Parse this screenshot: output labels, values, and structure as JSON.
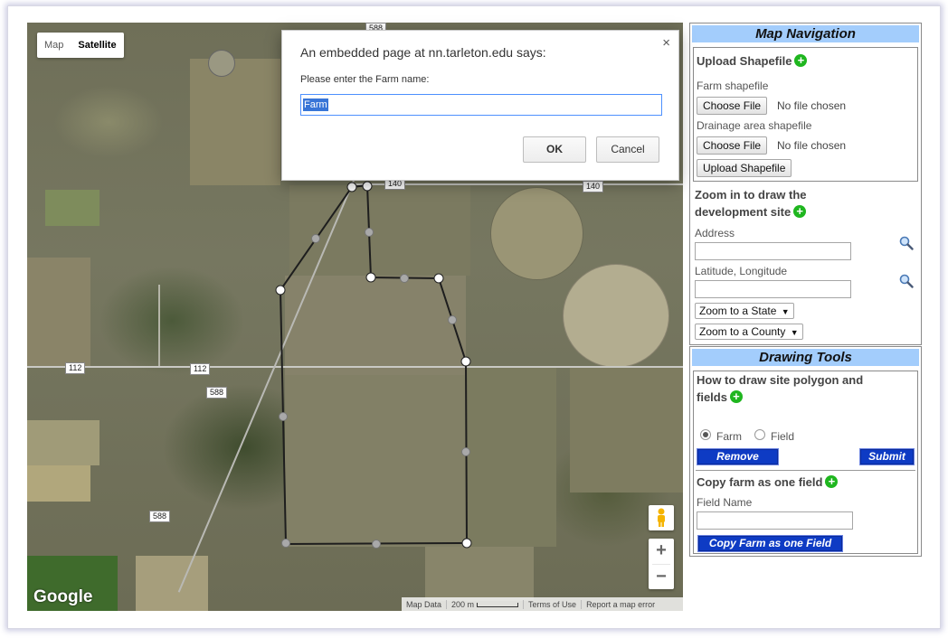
{
  "map": {
    "type_control": {
      "map_label": "Map",
      "satellite_label": "Satellite",
      "active": "Satellite"
    },
    "road_labels": [
      "588",
      "140",
      "140",
      "112",
      "112",
      "588",
      "588"
    ],
    "google_logo": "Google",
    "attribution": {
      "map_data": "Map Data",
      "scale": "200 m",
      "terms": "Terms of Use",
      "report": "Report a map error"
    },
    "zoom_in_label": "+",
    "zoom_out_label": "−",
    "icons": [
      "pegman-icon"
    ]
  },
  "dialog": {
    "title": "An embedded page at nn.tarleton.edu says:",
    "message": "Please enter the Farm name:",
    "input_value": "Farm",
    "ok_label": "OK",
    "cancel_label": "Cancel",
    "close_label": "×"
  },
  "sidebar": {
    "map_navigation": {
      "header": "Map Navigation",
      "upload": {
        "title": "Upload Shapefile",
        "farm_label": "Farm shapefile",
        "farm_button": "Choose File",
        "farm_status": "No file chosen",
        "drainage_label": "Drainage area shapefile",
        "drainage_button": "Choose File",
        "drainage_status": "No file chosen",
        "upload_button": "Upload Shapefile"
      },
      "zoom": {
        "title_line1": "Zoom in to draw the",
        "title_line2": "development site",
        "address_label": "Address",
        "address_value": "",
        "latlng_label": "Latitude, Longitude",
        "latlng_value": "",
        "state_select": "Zoom to a State",
        "county_select": "Zoom to a County"
      }
    },
    "drawing_tools": {
      "header": "Drawing Tools",
      "howto_line1": "How to draw site polygon and",
      "howto_line2": "fields",
      "radio_farm": "Farm",
      "radio_field": "Field",
      "selected": "Farm",
      "remove_button": "Remove",
      "submit_button": "Submit",
      "copy_title": "Copy farm as one field",
      "field_name_label": "Field Name",
      "field_name_value": "",
      "copy_button": "Copy Farm as one Field"
    }
  },
  "colors": {
    "panel_header": "#a3cdfc",
    "blue_button": "#0e3bc4",
    "plus_green": "#1fb61f",
    "dialog_focus": "#4d90fe"
  }
}
